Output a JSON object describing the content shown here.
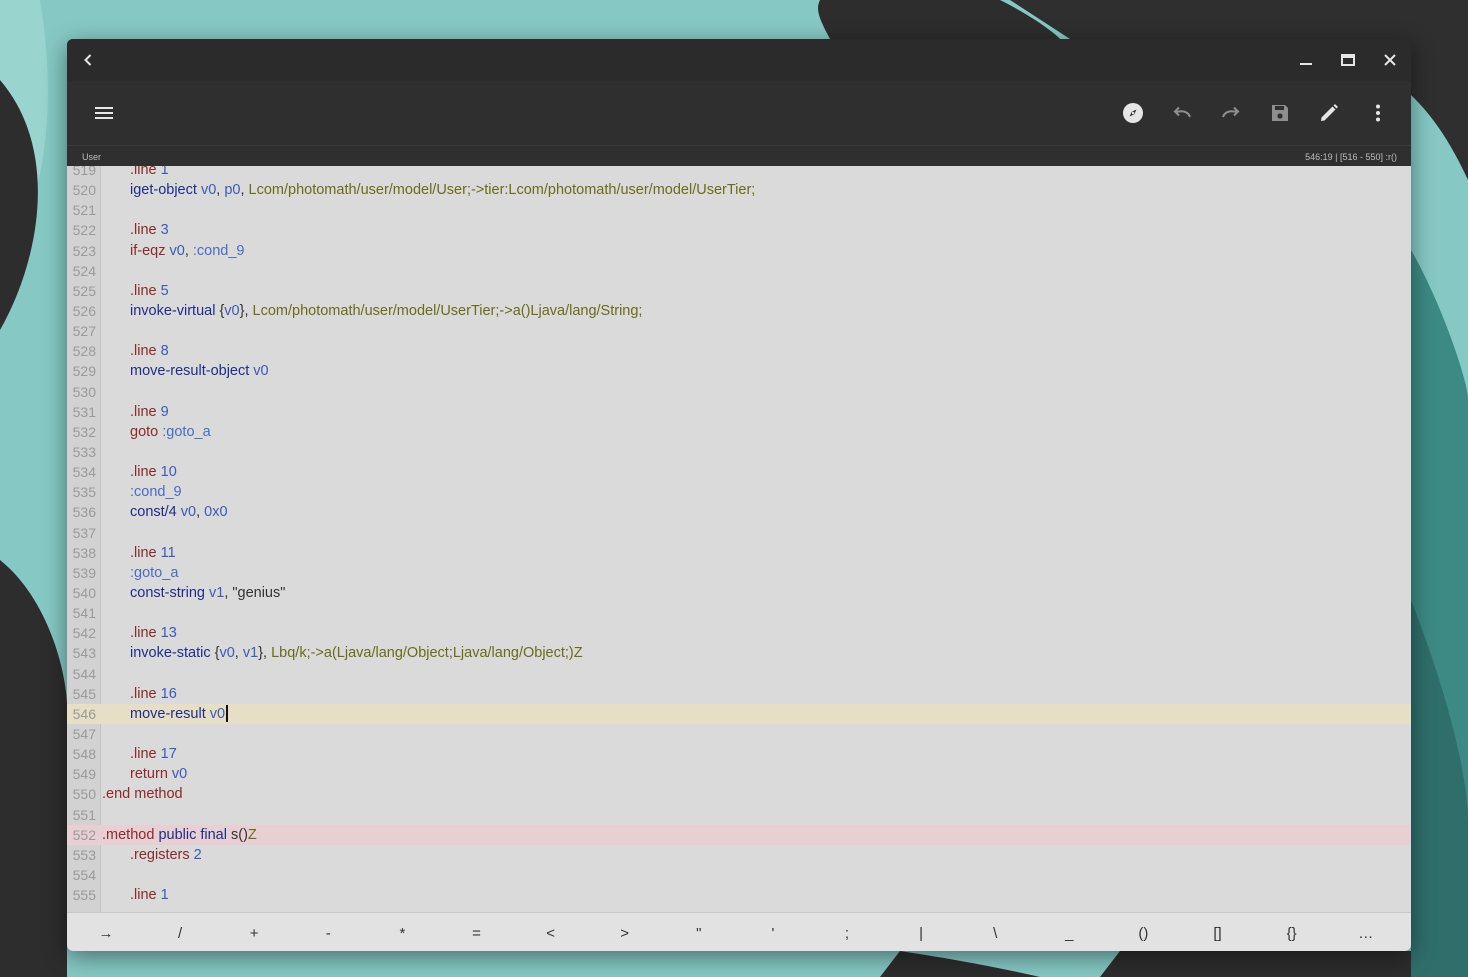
{
  "colors": {
    "accent_current_line": "#e7dec6",
    "method_line": "#e8cfd3",
    "keyword": "#1f2d8a",
    "directive": "#8a2a2a",
    "register": "#3b5bb5",
    "type": "#6b6b1a"
  },
  "titlebar": {
    "back_icon": "chevron-left-icon",
    "minimize_icon": "minimize-icon",
    "maximize_icon": "maximize-icon",
    "close_icon": "close-icon"
  },
  "toolbar": {
    "menu_icon": "hamburger-menu-icon",
    "actions": [
      "compass-icon",
      "undo-icon",
      "redo-icon",
      "save-icon",
      "pencil-icon",
      "more-vert-icon"
    ]
  },
  "status": {
    "filename": "User",
    "position": "546:19 | [516 - 550] :r()"
  },
  "editor": {
    "current_line": 546,
    "lines": [
      {
        "n": "519",
        "indent": 1,
        "tokens": [
          {
            "t": ".line",
            "c": "dir"
          },
          {
            "t": " "
          },
          {
            "t": "1",
            "c": "num-t"
          }
        ]
      },
      {
        "n": "520",
        "indent": 1,
        "tokens": [
          {
            "t": "iget-object",
            "c": "kw"
          },
          {
            "t": " "
          },
          {
            "t": "v0",
            "c": "reg"
          },
          {
            "t": ", "
          },
          {
            "t": "p0",
            "c": "reg"
          },
          {
            "t": ", "
          },
          {
            "t": "Lcom/photomath/user/model/User;->tier:Lcom/photomath/user/model/UserTier;",
            "c": "typ"
          }
        ]
      },
      {
        "n": "521",
        "indent": 0,
        "tokens": []
      },
      {
        "n": "522",
        "indent": 1,
        "tokens": [
          {
            "t": ".line",
            "c": "dir"
          },
          {
            "t": " "
          },
          {
            "t": "3",
            "c": "num-t"
          }
        ]
      },
      {
        "n": "523",
        "indent": 1,
        "tokens": [
          {
            "t": "if-eqz",
            "c": "dir"
          },
          {
            "t": " "
          },
          {
            "t": "v0",
            "c": "reg"
          },
          {
            "t": ", "
          },
          {
            "t": ":cond_9",
            "c": "lbl"
          }
        ]
      },
      {
        "n": "524",
        "indent": 0,
        "tokens": []
      },
      {
        "n": "525",
        "indent": 1,
        "tokens": [
          {
            "t": ".line",
            "c": "dir"
          },
          {
            "t": " "
          },
          {
            "t": "5",
            "c": "num-t"
          }
        ]
      },
      {
        "n": "526",
        "indent": 1,
        "tokens": [
          {
            "t": "invoke-virtual",
            "c": "kw"
          },
          {
            "t": " {"
          },
          {
            "t": "v0",
            "c": "reg"
          },
          {
            "t": "}, "
          },
          {
            "t": "Lcom/photomath/user/model/UserTier;->a()Ljava/lang/String;",
            "c": "typ"
          }
        ]
      },
      {
        "n": "527",
        "indent": 0,
        "tokens": []
      },
      {
        "n": "528",
        "indent": 1,
        "tokens": [
          {
            "t": ".line",
            "c": "dir"
          },
          {
            "t": " "
          },
          {
            "t": "8",
            "c": "num-t"
          }
        ]
      },
      {
        "n": "529",
        "indent": 1,
        "tokens": [
          {
            "t": "move-result-object",
            "c": "kw"
          },
          {
            "t": " "
          },
          {
            "t": "v0",
            "c": "reg"
          }
        ]
      },
      {
        "n": "530",
        "indent": 0,
        "tokens": []
      },
      {
        "n": "531",
        "indent": 1,
        "tokens": [
          {
            "t": ".line",
            "c": "dir"
          },
          {
            "t": " "
          },
          {
            "t": "9",
            "c": "num-t"
          }
        ]
      },
      {
        "n": "532",
        "indent": 1,
        "tokens": [
          {
            "t": "goto",
            "c": "dir"
          },
          {
            "t": " "
          },
          {
            "t": ":goto_a",
            "c": "lbl"
          }
        ]
      },
      {
        "n": "533",
        "indent": 0,
        "tokens": []
      },
      {
        "n": "534",
        "indent": 1,
        "tokens": [
          {
            "t": ".line",
            "c": "dir"
          },
          {
            "t": " "
          },
          {
            "t": "10",
            "c": "num-t"
          }
        ]
      },
      {
        "n": "535",
        "indent": 1,
        "tokens": [
          {
            "t": ":cond_9",
            "c": "lbl"
          }
        ]
      },
      {
        "n": "536",
        "indent": 1,
        "tokens": [
          {
            "t": "const/4",
            "c": "kw"
          },
          {
            "t": " "
          },
          {
            "t": "v0",
            "c": "reg"
          },
          {
            "t": ", "
          },
          {
            "t": "0x0",
            "c": "num-t"
          }
        ]
      },
      {
        "n": "537",
        "indent": 0,
        "tokens": []
      },
      {
        "n": "538",
        "indent": 1,
        "tokens": [
          {
            "t": ".line",
            "c": "dir"
          },
          {
            "t": " "
          },
          {
            "t": "11",
            "c": "num-t"
          }
        ]
      },
      {
        "n": "539",
        "indent": 1,
        "tokens": [
          {
            "t": ":goto_a",
            "c": "lbl"
          }
        ]
      },
      {
        "n": "540",
        "indent": 1,
        "tokens": [
          {
            "t": "const-string",
            "c": "kw"
          },
          {
            "t": " "
          },
          {
            "t": "v1",
            "c": "reg"
          },
          {
            "t": ", "
          },
          {
            "t": "\"genius\"",
            "c": "str"
          }
        ]
      },
      {
        "n": "541",
        "indent": 0,
        "tokens": []
      },
      {
        "n": "542",
        "indent": 1,
        "tokens": [
          {
            "t": ".line",
            "c": "dir"
          },
          {
            "t": " "
          },
          {
            "t": "13",
            "c": "num-t"
          }
        ]
      },
      {
        "n": "543",
        "indent": 1,
        "tokens": [
          {
            "t": "invoke-static",
            "c": "kw"
          },
          {
            "t": " {"
          },
          {
            "t": "v0",
            "c": "reg"
          },
          {
            "t": ", "
          },
          {
            "t": "v1",
            "c": "reg"
          },
          {
            "t": "}, "
          },
          {
            "t": "Lbq/k;->a(Ljava/lang/Object;Ljava/lang/Object;)Z",
            "c": "typ"
          }
        ]
      },
      {
        "n": "544",
        "indent": 0,
        "tokens": []
      },
      {
        "n": "545",
        "indent": 1,
        "tokens": [
          {
            "t": ".line",
            "c": "dir"
          },
          {
            "t": " "
          },
          {
            "t": "16",
            "c": "num-t"
          }
        ]
      },
      {
        "n": "546",
        "indent": 1,
        "hl": "current",
        "caret": true,
        "tokens": [
          {
            "t": "move-result",
            "c": "kw"
          },
          {
            "t": " "
          },
          {
            "t": "v0",
            "c": "reg"
          }
        ]
      },
      {
        "n": "547",
        "indent": 0,
        "tokens": []
      },
      {
        "n": "548",
        "indent": 1,
        "tokens": [
          {
            "t": ".line",
            "c": "dir"
          },
          {
            "t": " "
          },
          {
            "t": "17",
            "c": "num-t"
          }
        ]
      },
      {
        "n": "549",
        "indent": 1,
        "tokens": [
          {
            "t": "return",
            "c": "dir"
          },
          {
            "t": " "
          },
          {
            "t": "v0",
            "c": "reg"
          }
        ]
      },
      {
        "n": "550",
        "indent": 0,
        "tokens": [
          {
            "t": ".end method",
            "c": "dir"
          }
        ]
      },
      {
        "n": "551",
        "indent": 0,
        "tokens": []
      },
      {
        "n": "552",
        "indent": 0,
        "hl": "method",
        "tokens": [
          {
            "t": ".method",
            "c": "dir"
          },
          {
            "t": " "
          },
          {
            "t": "public",
            "c": "kw"
          },
          {
            "t": " "
          },
          {
            "t": "final",
            "c": "kw"
          },
          {
            "t": " "
          },
          {
            "t": "s()",
            "c": "plain"
          },
          {
            "t": "Z",
            "c": "typ"
          }
        ]
      },
      {
        "n": "553",
        "indent": 1,
        "tokens": [
          {
            "t": ".registers",
            "c": "dir"
          },
          {
            "t": " "
          },
          {
            "t": "2",
            "c": "num-t"
          }
        ]
      },
      {
        "n": "554",
        "indent": 0,
        "tokens": []
      },
      {
        "n": "555",
        "indent": 1,
        "tokens": [
          {
            "t": ".line",
            "c": "dir"
          },
          {
            "t": " "
          },
          {
            "t": "1",
            "c": "num-t"
          }
        ]
      }
    ]
  },
  "symbol_keys": [
    "→",
    "/",
    "+",
    "-",
    "*",
    "=",
    "<",
    ">",
    "\"",
    "'",
    ";",
    "|",
    "\\",
    "_",
    "()",
    "[]",
    "{}",
    "…"
  ]
}
